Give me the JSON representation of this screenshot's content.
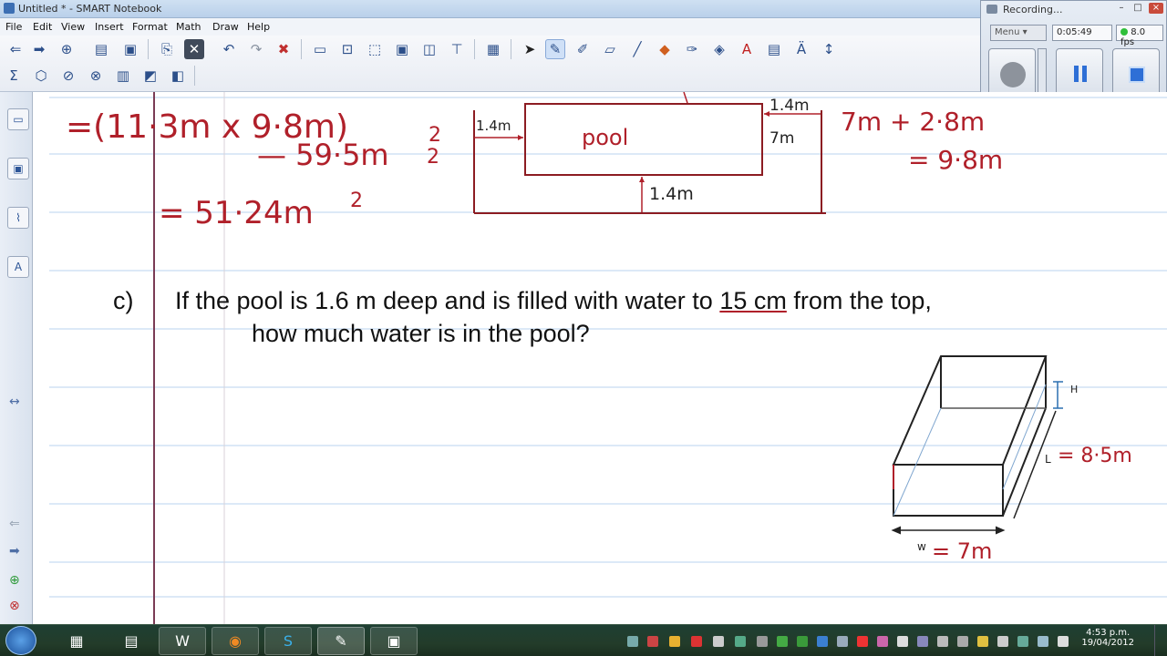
{
  "window": {
    "title": "Untitled * - SMART Notebook"
  },
  "menu": {
    "items": [
      "File",
      "Edit",
      "View",
      "Insert",
      "Format",
      "Math",
      "Draw",
      "Help"
    ]
  },
  "question": {
    "label": "c)",
    "line1_before": "If the pool is 1.6 m deep and is filled with water to ",
    "line1_underlined": "15 cm",
    "line1_after": " from the top,",
    "line2": "how much water is in the pool?"
  },
  "handwriting": {
    "area_line1": "=(11·3m x 9·8m)",
    "area_power1": "2",
    "area_line2": "— 59·5m",
    "area_power2": "2",
    "area_result": "= 51·24m",
    "area_power3": "2",
    "pool_label": "pool",
    "left_dim": "1.4m",
    "right_dim": "1.4m",
    "right_side": "7m",
    "bottom_dim": "1.4m",
    "sum_line1": "7m + 2·8m",
    "sum_line2": "= 9·8m",
    "box_height_label": "H",
    "box_length_prefix": "L",
    "box_length": "= 8·5m",
    "box_width_prefix": "w",
    "box_width": "= 7m"
  },
  "recorder": {
    "title": "Recording...",
    "menu_label": "Menu",
    "elapsed": "0:05:49",
    "fps": "8.0 fps"
  },
  "taskbar": {
    "time": "4:53 p.m.",
    "date": "19/04/2012"
  },
  "colors": {
    "ink_red": "#b0202a",
    "ink_dark_red": "#8c1c22",
    "ink_black": "#222222",
    "rule_blue": "#c8dcf2",
    "margin_purple": "#7a3b55"
  }
}
